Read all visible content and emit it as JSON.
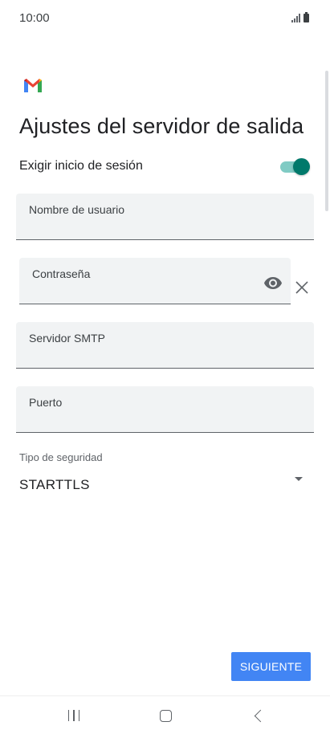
{
  "status_bar": {
    "time": "10:00",
    "signal_icon": "signal-icon",
    "battery_icon": "battery-icon"
  },
  "header": {
    "logo_icon": "gmail-logo-icon",
    "title": "Ajustes del servidor de salida"
  },
  "login_toggle": {
    "label": "Exigir inicio de sesión",
    "enabled": true
  },
  "fields": {
    "username": {
      "label": "Nombre de usuario",
      "value": ""
    },
    "password": {
      "label": "Contraseña",
      "value": "",
      "reveal_icon": "eye-icon",
      "clear_icon": "close-icon"
    },
    "smtp_server": {
      "label": "Servidor SMTP",
      "value": ""
    },
    "port": {
      "label": "Puerto",
      "value": ""
    }
  },
  "security": {
    "label": "Tipo de seguridad",
    "selected": "STARTTLS",
    "dropdown_icon": "caret-down-icon"
  },
  "actions": {
    "next_label": "SIGUIENTE"
  },
  "nav_bar": {
    "recents_icon": "recents-icon",
    "home_icon": "home-icon",
    "back_icon": "back-icon"
  },
  "colors": {
    "accent": "#4285f4",
    "toggle_thumb": "#00796b",
    "toggle_track": "#80cbc4",
    "field_background": "#f1f3f4"
  }
}
